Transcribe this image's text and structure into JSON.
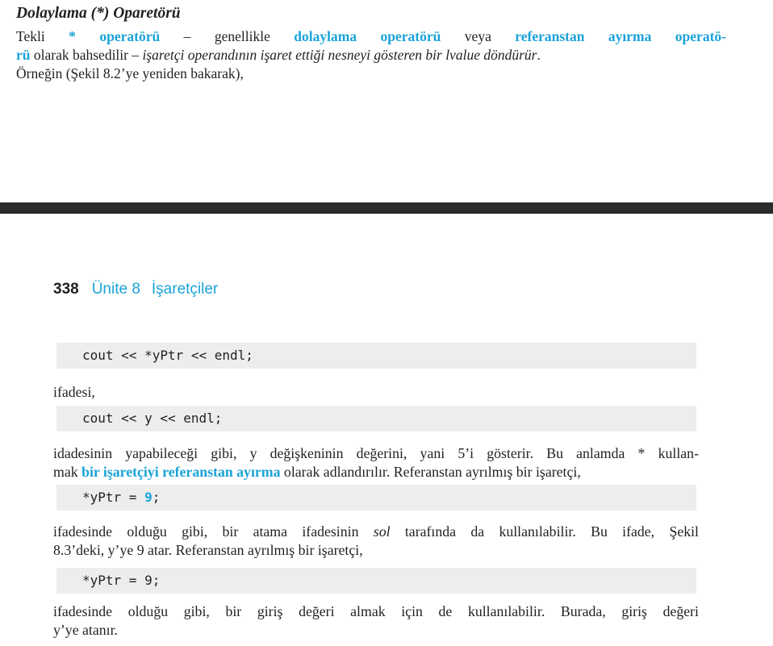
{
  "top": {
    "heading": "Dolaylama (*) Oparetörü",
    "para": {
      "l1_a": "Tekli ",
      "l1_b": "* operatörü",
      "l1_c": " – genellikle ",
      "l1_d": "dolaylama operatörü",
      "l1_e": " veya ",
      "l1_f": "referanstan ayırma operatö-",
      "l2_a": "rü",
      "l2_b": " olarak bahsedilir – ",
      "l2_c": "işaretçi operandının işaret ettiği nesneyi gösteren bir lvalue döndürür",
      "l2_d": ".",
      "l3": "Örneğin (Şekil 8.2’ye yeniden bakarak),"
    }
  },
  "running_head": {
    "page_number": "338",
    "unit": "Ünite 8",
    "chapter": "İşaretçiler"
  },
  "code": {
    "c1": "cout << *yPtr << endl;",
    "c2": "cout << y << endl;",
    "c3_a": "*yPtr = ",
    "c3_b": "9",
    "c3_c": ";",
    "c4": "*yPtr = 9;"
  },
  "body": {
    "t1": "ifadesi,",
    "t2_l1": "idadesinin yapabileceği gibi, y değişkeninin değerini, yani 5’i gösterir. Bu anlamda * kullan-",
    "t2_l2_a": "mak ",
    "t2_l2_b": "bir işaretçiyi referanstan ayırma",
    "t2_l2_c": " olarak adlandırılır. Referanstan ayrılmış bir işaretçi,",
    "t3_l1_a": "ifadesinde olduğu gibi, bir atama ifadesinin ",
    "t3_l1_b": "sol",
    "t3_l1_c": " tarafında da kullanılabilir. Bu ifade, Şekil",
    "t3_l2": "8.3’deki, y’ye 9 atar. Referanstan ayrılmış bir işaretçi,",
    "t4_l1": "ifadesinde olduğu gibi, bir giriş değeri almak için de kullanılabilir. Burada, giriş değeri",
    "t4_l2": "y’ye atanır."
  }
}
